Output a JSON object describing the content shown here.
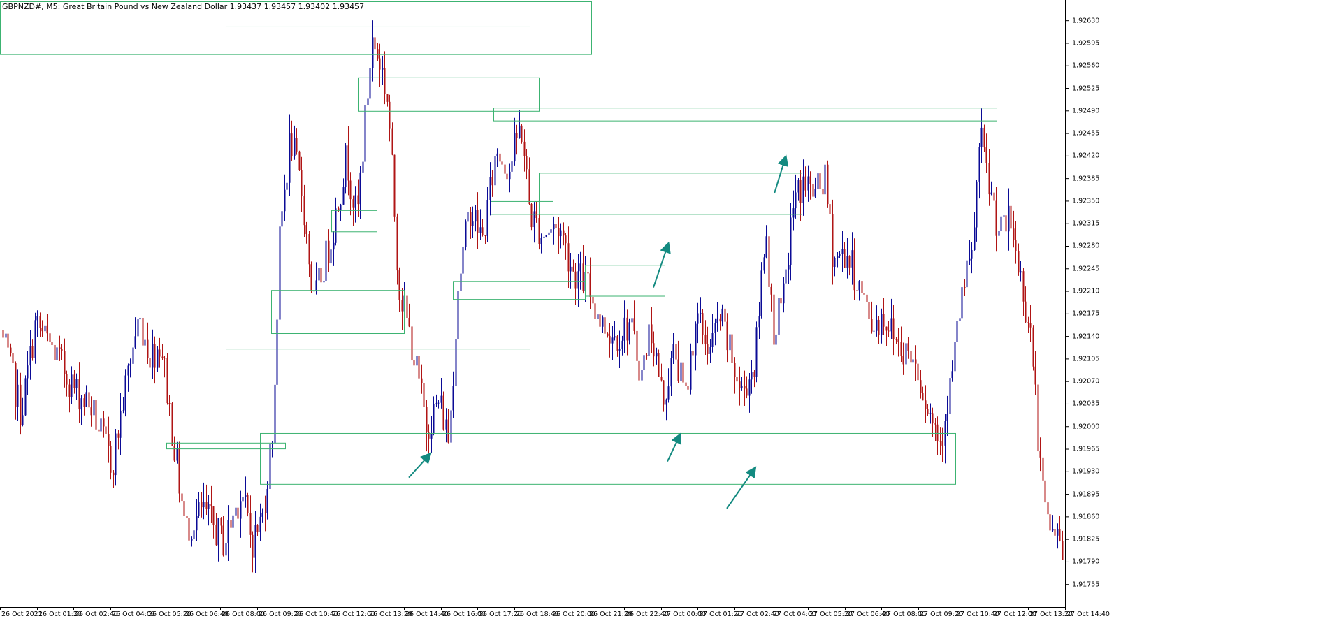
{
  "header": {
    "symbol_line": "GBPNZD#, M5:  Great Britain Pound vs New Zealand Dollar  1.93437 1.93457 1.93402 1.93457"
  },
  "colors": {
    "bull": "#0b0b96",
    "bear": "#b01515",
    "zone": "#3cb371",
    "arrow": "#138a80",
    "axis": "#000000"
  },
  "chart_data": {
    "type": "candlestick",
    "timeframe": "M5",
    "ylim": [
      1.9172,
      1.9266
    ],
    "yticks": [
      1.9263,
      1.92595,
      1.9256,
      1.92525,
      1.9249,
      1.92455,
      1.9242,
      1.92385,
      1.9235,
      1.92315,
      1.9228,
      1.92245,
      1.9221,
      1.92175,
      1.9214,
      1.92105,
      1.9207,
      1.92035,
      1.92,
      1.91965,
      1.9193,
      1.91895,
      1.9186,
      1.91825,
      1.9179,
      1.91755
    ],
    "ytick_labels": [
      "1.92630",
      "1.92595",
      "1.92560",
      "1.92525",
      "1.92490",
      "1.92455",
      "1.92420",
      "1.92385",
      "1.92350",
      "1.92315",
      "1.92280",
      "1.92245",
      "1.92210",
      "1.92175",
      "1.92140",
      "1.92105",
      "1.92070",
      "1.92035",
      "1.92000",
      "1.91965",
      "1.91930",
      "1.91895",
      "1.91860",
      "1.91825",
      "1.91790",
      "1.91755"
    ],
    "xtick_labels": [
      "26 Oct 2021",
      "26 Oct 01:20",
      "26 Oct 02:40",
      "26 Oct 04:00",
      "26 Oct 05:20",
      "26 Oct 06:40",
      "26 Oct 08:00",
      "26 Oct 09:20",
      "26 Oct 10:40",
      "26 Oct 12:00",
      "26 Oct 13:20",
      "26 Oct 14:40",
      "26 Oct 16:00",
      "26 Oct 17:20",
      "26 Oct 18:40",
      "26 Oct 20:00",
      "26 Oct 21:20",
      "26 Oct 22:40",
      "27 Oct 00:00",
      "27 Oct 01:20",
      "27 Oct 02:40",
      "27 Oct 04:00",
      "27 Oct 05:20",
      "27 Oct 06:40",
      "27 Oct 08:00",
      "27 Oct 09:20",
      "27 Oct 10:40",
      "27 Oct 12:00",
      "27 Oct 13:20",
      "27 Oct 14:40"
    ],
    "price_path_anchors": [
      [
        0,
        1.9215
      ],
      [
        30,
        1.9202
      ],
      [
        50,
        1.9216
      ],
      [
        75,
        1.9212
      ],
      [
        105,
        1.9206
      ],
      [
        130,
        1.9203
      ],
      [
        160,
        1.9194
      ],
      [
        185,
        1.921
      ],
      [
        198,
        1.9217
      ],
      [
        215,
        1.9211
      ],
      [
        230,
        1.9213
      ],
      [
        245,
        1.92
      ],
      [
        265,
        1.9184
      ],
      [
        290,
        1.9187
      ],
      [
        320,
        1.9182
      ],
      [
        345,
        1.919
      ],
      [
        360,
        1.9182
      ],
      [
        375,
        1.9186
      ],
      [
        390,
        1.92
      ],
      [
        400,
        1.923
      ],
      [
        415,
        1.9245
      ],
      [
        432,
        1.9236
      ],
      [
        448,
        1.9219
      ],
      [
        475,
        1.923
      ],
      [
        495,
        1.9242
      ],
      [
        510,
        1.9232
      ],
      [
        520,
        1.9245
      ],
      [
        532,
        1.926
      ],
      [
        545,
        1.9256
      ],
      [
        555,
        1.925
      ],
      [
        570,
        1.9222
      ],
      [
        590,
        1.9212
      ],
      [
        610,
        1.92
      ],
      [
        628,
        1.9204
      ],
      [
        642,
        1.9198
      ],
      [
        655,
        1.9222
      ],
      [
        672,
        1.9234
      ],
      [
        690,
        1.9229
      ],
      [
        710,
        1.9243
      ],
      [
        728,
        1.924
      ],
      [
        745,
        1.9247
      ],
      [
        758,
        1.9233
      ],
      [
        775,
        1.923
      ],
      [
        800,
        1.9231
      ],
      [
        820,
        1.9224
      ],
      [
        840,
        1.9222
      ],
      [
        860,
        1.9216
      ],
      [
        880,
        1.9214
      ],
      [
        900,
        1.9216
      ],
      [
        918,
        1.9208
      ],
      [
        930,
        1.9216
      ],
      [
        948,
        1.9204
      ],
      [
        965,
        1.9212
      ],
      [
        980,
        1.9204
      ],
      [
        995,
        1.9217
      ],
      [
        1015,
        1.9212
      ],
      [
        1030,
        1.9217
      ],
      [
        1045,
        1.9211
      ],
      [
        1060,
        1.9205
      ],
      [
        1080,
        1.921
      ],
      [
        1095,
        1.9232
      ],
      [
        1105,
        1.9215
      ],
      [
        1120,
        1.9219
      ],
      [
        1135,
        1.9235
      ],
      [
        1150,
        1.9238
      ],
      [
        1165,
        1.9236
      ],
      [
        1180,
        1.9238
      ],
      [
        1192,
        1.9226
      ],
      [
        1210,
        1.9227
      ],
      [
        1225,
        1.9223
      ],
      [
        1245,
        1.9216
      ],
      [
        1265,
        1.9217
      ],
      [
        1285,
        1.9213
      ],
      [
        1310,
        1.921
      ],
      [
        1330,
        1.9202
      ],
      [
        1345,
        1.9198
      ],
      [
        1360,
        1.9207
      ],
      [
        1375,
        1.922
      ],
      [
        1390,
        1.9226
      ],
      [
        1402,
        1.9245
      ],
      [
        1415,
        1.9237
      ],
      [
        1430,
        1.923
      ],
      [
        1445,
        1.9232
      ],
      [
        1460,
        1.9223
      ],
      [
        1475,
        1.9214
      ],
      [
        1490,
        1.919
      ],
      [
        1500,
        1.9184
      ],
      [
        1510,
        1.9184
      ],
      [
        1520,
        1.918
      ]
    ],
    "zones": [
      {
        "t1": 0,
        "t2": 846,
        "p_top": 1.9266,
        "p_bot": 1.92578
      },
      {
        "t1": 323,
        "t2": 758,
        "p_top": 1.92621,
        "p_bot": 1.92121
      },
      {
        "t1": 512,
        "t2": 771,
        "p_top": 1.92542,
        "p_bot": 1.9249
      },
      {
        "t1": 706,
        "t2": 1426,
        "p_top": 1.92495,
        "p_bot": 1.92475
      },
      {
        "t1": 771,
        "t2": 1147,
        "p_top": 1.92394,
        "p_bot": 1.9233
      },
      {
        "t1": 702,
        "t2": 791,
        "p_top": 1.9235,
        "p_bot": 1.9233
      },
      {
        "t1": 474,
        "t2": 539,
        "p_top": 1.92336,
        "p_bot": 1.92303
      },
      {
        "t1": 388,
        "t2": 578,
        "p_top": 1.92212,
        "p_bot": 1.92145
      },
      {
        "t1": 648,
        "t2": 837,
        "p_top": 1.92226,
        "p_bot": 1.92198
      },
      {
        "t1": 837,
        "t2": 951,
        "p_top": 1.92251,
        "p_bot": 1.92203
      },
      {
        "t1": 372,
        "t2": 1367,
        "p_top": 1.9199,
        "p_bot": 1.91911
      },
      {
        "t1": 238,
        "t2": 408,
        "p_top": 1.91975,
        "p_bot": 1.91966
      }
    ],
    "arrows": [
      {
        "t1": 585,
        "p1": 1.91921,
        "t2": 615,
        "p2": 1.91957
      },
      {
        "t1": 935,
        "p1": 1.92216,
        "t2": 956,
        "p2": 1.92283
      },
      {
        "t1": 955,
        "p1": 1.91946,
        "t2": 973,
        "p2": 1.91987
      },
      {
        "t1": 1040,
        "p1": 1.91873,
        "t2": 1080,
        "p2": 1.91935
      },
      {
        "t1": 1108,
        "p1": 1.92362,
        "t2": 1124,
        "p2": 1.92418
      }
    ],
    "grid": false,
    "legend": "none"
  }
}
